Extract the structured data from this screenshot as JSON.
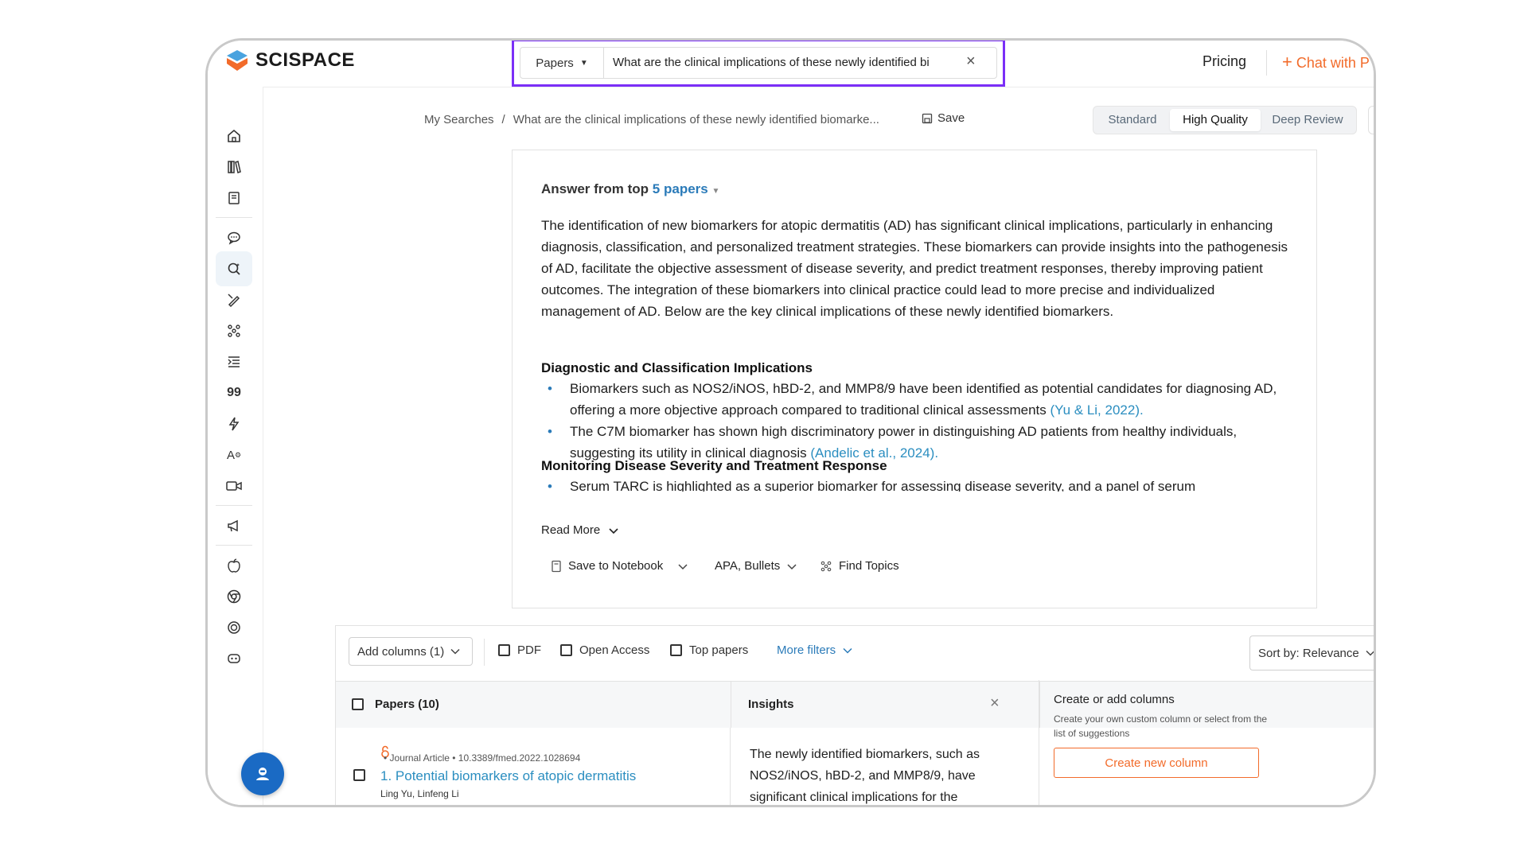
{
  "header": {
    "logo_text": "SCISPACE",
    "search_type": "Papers",
    "search_value": "What are the clinical implications of these newly identified bi",
    "pricing": "Pricing",
    "chat_label": "Chat with P"
  },
  "sidebar": {
    "icons": [
      "home-icon",
      "library-icon",
      "notebook-icon",
      "chat-icon",
      "literature-search-icon",
      "writer-icon",
      "topics-icon",
      "outline-icon",
      "citation-icon",
      "flash-icon",
      "ai-detector-icon",
      "video-icon",
      "announcement-icon",
      "apple-icon",
      "chrome-icon",
      "openai-icon",
      "discord-icon"
    ]
  },
  "breadcrumb": {
    "root": "My Searches",
    "separator": "/",
    "current": "What are the clinical implications of these newly identified biomarke...",
    "save": "Save"
  },
  "modes": {
    "items": [
      "Standard",
      "High Quality",
      "Deep Review"
    ],
    "selected": "High Quality"
  },
  "answer": {
    "heading_prefix": "Answer from top",
    "papers_link": "5 papers",
    "summary": "The identification of new biomarkers for atopic dermatitis (AD) has significant clinical implications, particularly in enhancing diagnosis, classification, and personalized treatment strategies. These biomarkers can provide insights into the pathogenesis of AD, facilitate the objective assessment of disease severity, and predict treatment responses, thereby improving patient outcomes. The integration of these biomarkers into clinical practice could lead to more precise and individualized management of AD. Below are the key clinical implications of these newly identified biomarkers.",
    "section1_title": "Diagnostic and Classification Implications",
    "section1_bullets": [
      {
        "text": "Biomarkers such as NOS2/iNOS, hBD-2, and MMP8/9 have been identified as potential candidates for diagnosing AD, offering a more objective approach compared to traditional clinical assessments",
        "cite": "(Yu & Li, 2022)."
      },
      {
        "text": "The C7M biomarker has shown high discriminatory power in distinguishing AD patients from healthy individuals, suggesting its utility in clinical diagnosis",
        "cite": "(Andelic et al., 2024)."
      }
    ],
    "section2_title": "Monitoring Disease Severity and Treatment Response",
    "section2_bullets": [
      {
        "text": "Serum TARC is highlighted as a superior biomarker for assessing disease severity, and a panel of serum",
        "cite": ""
      }
    ],
    "read_more": "Read More",
    "actions": {
      "save_notebook": "Save to Notebook",
      "citation_style": "APA, Bullets",
      "find_topics": "Find Topics"
    }
  },
  "filters": {
    "add_columns": "Add columns (1)",
    "pdf": "PDF",
    "open_access": "Open Access",
    "top_papers": "Top papers",
    "more_filters": "More filters",
    "sort": "Sort by: Relevance"
  },
  "table": {
    "col_papers": "Papers (10)",
    "col_insights": "Insights",
    "rows": [
      {
        "meta": "• Journal Article • 10.3389/fmed.2022.1028694",
        "title": "1. Potential biomarkers of atopic dermatitis",
        "authors": "Ling Yu, Linfeng Li",
        "insight": "The newly identified biomarkers, such as NOS2/iNOS, hBD-2, and MMP8/9, have significant clinical implications for the diagnosis and"
      }
    ],
    "create_panel": {
      "title": "Create or add columns",
      "description": "Create your own custom column or select from the list of suggestions",
      "button": "Create new column"
    }
  },
  "colors": {
    "accent": "#2b7bb9",
    "brand_orange": "#f26b2a",
    "highlight": "#7b2ff7"
  }
}
